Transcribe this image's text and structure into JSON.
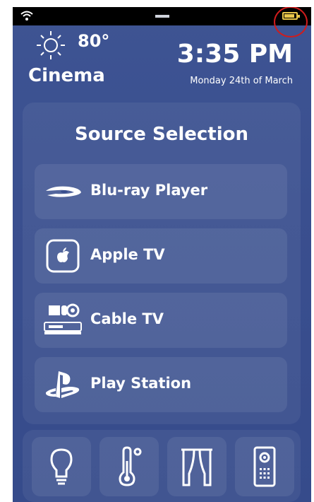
{
  "status": {
    "wifi_icon": "wifi-icon",
    "battery_icon": "battery-icon",
    "battery_level": 0.75
  },
  "header": {
    "weather_icon": "sun-icon",
    "temperature": "80°",
    "room": "Cinema",
    "time": "3:35 PM",
    "date": "Monday 24th of March"
  },
  "sources": {
    "title": "Source Selection",
    "items": [
      {
        "label": "Blu-ray Player",
        "icon": "bluray-disc-icon"
      },
      {
        "label": "Apple TV",
        "icon": "apple-tv-icon"
      },
      {
        "label": "Cable TV",
        "icon": "cable-box-icon"
      },
      {
        "label": "Play Station",
        "icon": "playstation-icon"
      }
    ]
  },
  "dock": {
    "items": [
      {
        "icon": "lightbulb-icon"
      },
      {
        "icon": "thermometer-icon"
      },
      {
        "icon": "curtains-icon"
      },
      {
        "icon": "intercom-icon"
      }
    ]
  },
  "colors": {
    "background": "#3a4f8f",
    "text": "#ffffff",
    "highlight_ring": "#d01c1c",
    "battery": "#e8c64a"
  }
}
